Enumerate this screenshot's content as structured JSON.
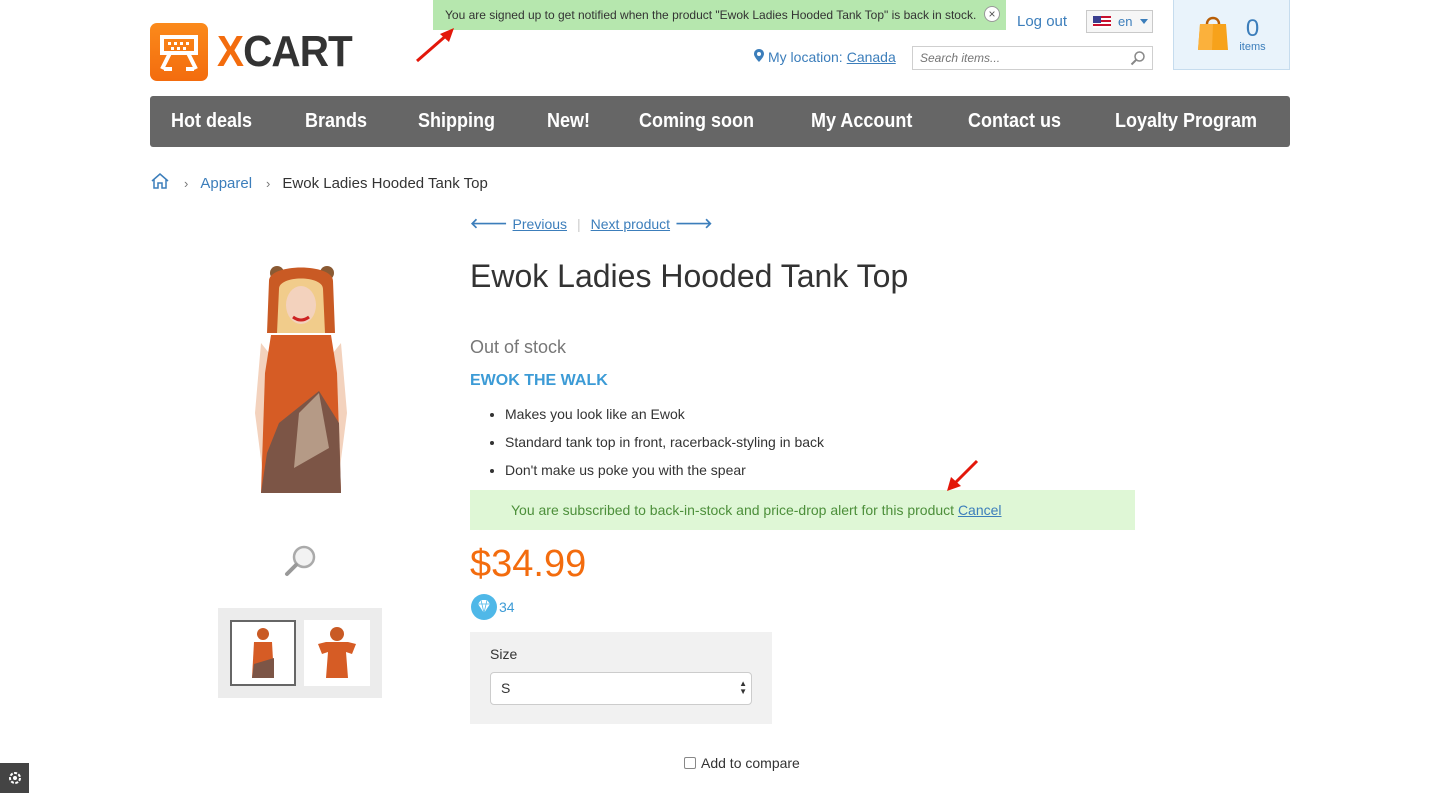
{
  "notification": {
    "text": "You are signed up to get notified when the product \"Ewok Ladies Hooded Tank Top\" is back in stock."
  },
  "logo": {
    "text_x": "X",
    "text_rest": "CART"
  },
  "header": {
    "logout": "Log out",
    "language": "en",
    "location_label": "My location:",
    "location_value": "Canada",
    "search_placeholder": "Search items...",
    "cart_count": "0",
    "cart_label": "items"
  },
  "nav": [
    "Hot deals",
    "Brands",
    "Shipping",
    "New!",
    "Coming soon",
    "My Account",
    "Contact us",
    "Loyalty Program"
  ],
  "breadcrumb": {
    "category": "Apparel",
    "current": "Ewok Ladies Hooded Tank Top"
  },
  "product_nav": {
    "previous": "Previous",
    "next": "Next product"
  },
  "product": {
    "title": "Ewok Ladies Hooded Tank Top",
    "stock": "Out of stock",
    "subhead": "EWOK THE WALK",
    "features": [
      "Makes you look like an Ewok",
      "Standard tank top in front, racerback-styling in back",
      "Don't make us poke you with the spear"
    ],
    "alert_text": "You are subscribed to back-in-stock and price-drop alert for this product",
    "alert_cancel": "Cancel",
    "price": "$34.99",
    "points": "34",
    "option_label": "Size",
    "option_value": "S",
    "compare": "Add to compare"
  },
  "colors": {
    "accent": "#f36c0e",
    "link": "#3c7ebb",
    "nav_bg": "#666666",
    "alert_bg": "#dff7d6"
  }
}
